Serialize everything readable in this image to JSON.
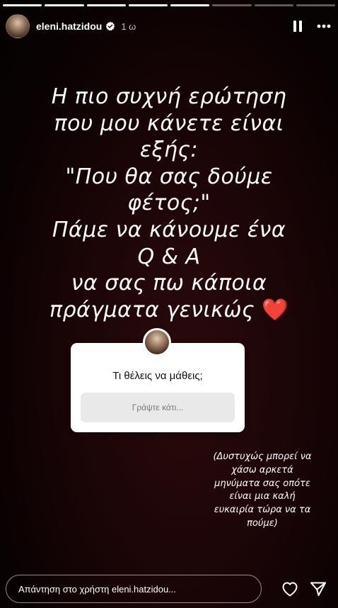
{
  "progress": {
    "segments": 8,
    "completed": 5
  },
  "header": {
    "username": "eleni.hatzidou",
    "verified": true,
    "time_ago": "1 ω"
  },
  "story": {
    "lines": [
      "Η πιο συχνή ερώτηση",
      "που μου κάνετε είναι",
      "εξής:",
      "\"Που θα σας δούμε",
      "φέτος;\"",
      "Πάμε να κάνουμε ένα",
      "Q & A",
      "να σας πω κάποια",
      "πράγματα γενικώς"
    ],
    "heart": "❤️"
  },
  "question_sticker": {
    "question": "Τι θέλεις να μάθεις;",
    "placeholder": "Γράψτε κάτι..."
  },
  "note": {
    "lines": [
      "(Δυστυχώς μπορεί να",
      "χάσω αρκετά",
      "μηνύματα σας οπότε",
      "είναι μια καλή",
      "ευκαιρία τώρα να τα",
      "πούμε)"
    ]
  },
  "reply": {
    "placeholder": "Απάντηση στο χρήστη eleni.hatzidou..."
  },
  "colors": {
    "background": "#1a0506",
    "heart": "#e0242d",
    "verified": "#ffffff"
  }
}
